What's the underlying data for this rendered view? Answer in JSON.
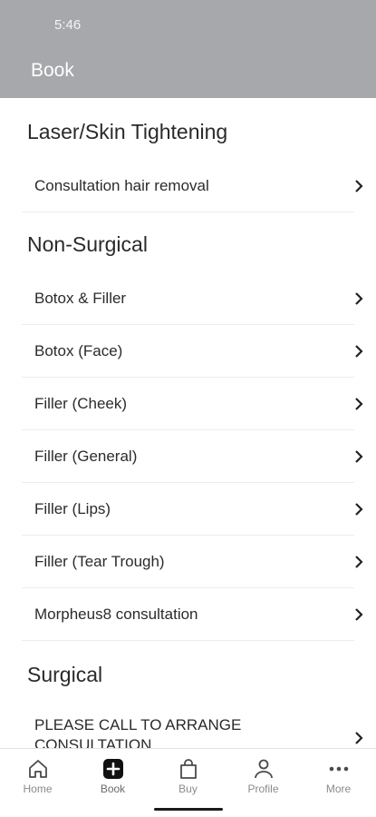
{
  "status_bar": {
    "time": "5:46"
  },
  "header": {
    "title": "Book"
  },
  "sections": [
    {
      "title": "Laser/Skin Tightening",
      "items": [
        "Consultation hair removal"
      ]
    },
    {
      "title": "Non-Surgical",
      "items": [
        "Botox & Filler",
        "Botox (Face)",
        "Filler (Cheek)",
        "Filler (General)",
        "Filler (Lips)",
        "Filler (Tear Trough)",
        "Morpheus8 consultation"
      ]
    },
    {
      "title": "Surgical",
      "items": [
        "PLEASE CALL TO ARRANGE CONSULTATION"
      ]
    }
  ],
  "tabbar": {
    "tabs": [
      {
        "label": "Home",
        "icon": "home-icon"
      },
      {
        "label": "Book",
        "icon": "plus-square-icon"
      },
      {
        "label": "Buy",
        "icon": "shopping-bag-icon"
      },
      {
        "label": "Profile",
        "icon": "person-icon"
      },
      {
        "label": "More",
        "icon": "more-dots-icon"
      }
    ],
    "active": "Book"
  },
  "colors": {
    "header_bg": "#a7a8ab",
    "tab_inactive": "#8a8a8a"
  }
}
